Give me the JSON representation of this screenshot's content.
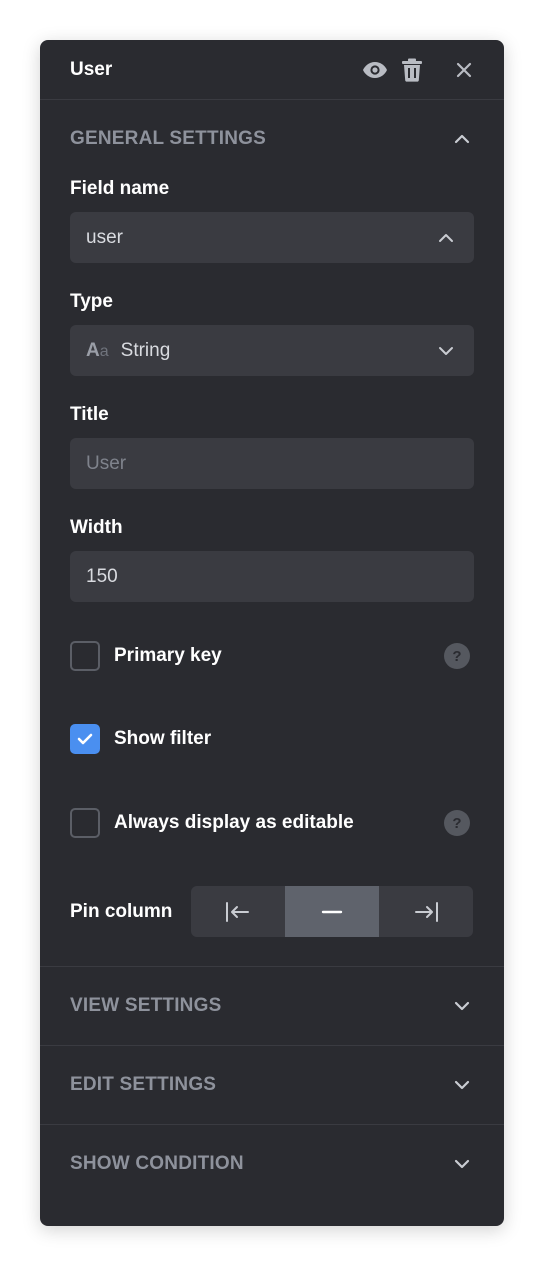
{
  "header": {
    "title": "User",
    "icons": [
      "eye-icon",
      "trash-icon",
      "close-icon"
    ]
  },
  "general": {
    "title": "GENERAL SETTINGS",
    "field_name": {
      "label": "Field name",
      "value": "user"
    },
    "type": {
      "label": "Type",
      "icon_main": "A",
      "icon_sub": "a",
      "value": "String"
    },
    "title_field": {
      "label": "Title",
      "placeholder": "User"
    },
    "width": {
      "label": "Width",
      "value": "150"
    },
    "primary_key": {
      "label": "Primary key",
      "checked": false,
      "help": "?"
    },
    "show_filter": {
      "label": "Show filter",
      "checked": true
    },
    "always_editable": {
      "label": "Always display as editable",
      "checked": false,
      "help": "?"
    },
    "pin_column": {
      "label": "Pin column",
      "options": [
        "pin-left",
        "pin-none",
        "pin-right"
      ],
      "selected": "pin-none"
    }
  },
  "sections": [
    {
      "title": "VIEW SETTINGS"
    },
    {
      "title": "EDIT SETTINGS"
    },
    {
      "title": "SHOW CONDITION"
    }
  ],
  "colors": {
    "panel_bg": "#2a2b30",
    "field_bg": "#3a3b41",
    "accent": "#4a8ff0",
    "section_title": "#8e929c"
  }
}
